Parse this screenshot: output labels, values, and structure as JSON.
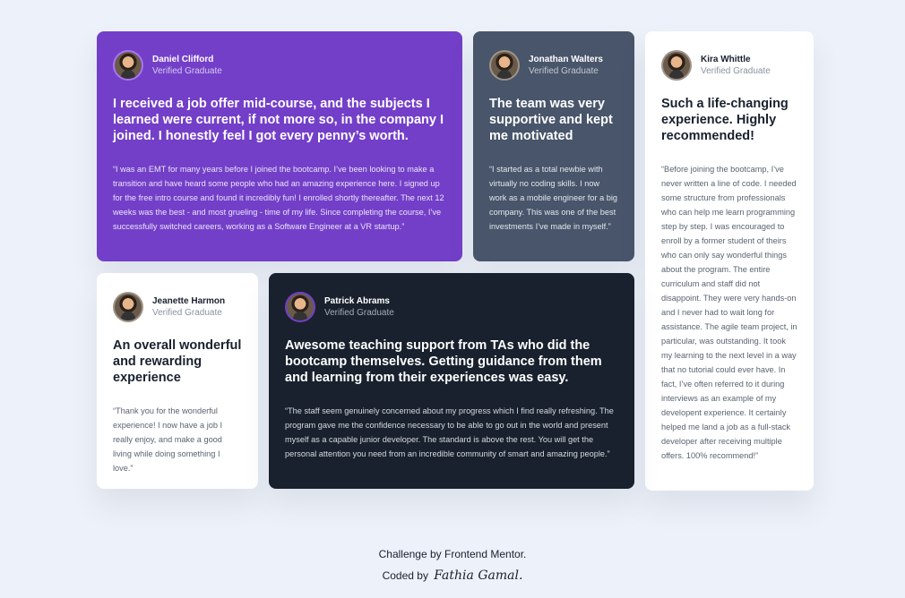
{
  "testimonials": [
    {
      "name": "Daniel Clifford",
      "status": "Verified Graduate",
      "headline": "I received a job offer mid-course, and the subjects I learned were current, if not more so, in the company I joined. I honestly feel I got every penny’s worth.",
      "quote": "“I was an EMT for many years before I joined the bootcamp. I’ve been looking to make a transition and have heard some people who had an amazing experience here. I signed up for the free intro course and found it incredibly fun! I enrolled shortly thereafter. The next 12 weeks was the best - and most grueling - time of my life. Since completing the course, I’ve successfully switched careers, working as a Software Engineer at a VR startup.”"
    },
    {
      "name": "Jonathan Walters",
      "status": "Verified Graduate",
      "headline": "The team was very supportive and kept me motivated",
      "quote": "“I started as a total newbie with virtually no coding skills. I now work as a mobile engineer for a big company. This was one of the best investments I’ve made in myself.”"
    },
    {
      "name": "Kira Whittle",
      "status": "Verified Graduate",
      "headline": "Such a life-changing experience. Highly recommended!",
      "quote": "“Before joining the bootcamp, I’ve never written a line of code. I needed some structure from professionals who can help me learn programming step by step. I was encouraged to enroll by a former student of theirs who can only say wonderful things about the program. The entire curriculum and staff did not disappoint. They were very hands-on and I never had to wait long for assistance. The agile team project, in particular, was outstanding. It took my learning to the next level in a way that no tutorial could ever have. In fact, I’ve often referred to it during interviews as an example of my developent experience. It certainly helped me land a job as a full-stack developer after receiving multiple offers. 100% recommend!”"
    },
    {
      "name": "Jeanette Harmon",
      "status": "Verified Graduate",
      "headline": "An overall wonderful and rewarding experience",
      "quote": "“Thank you for the wonderful experience! I now have a job I really enjoy, and make a good living while doing something I love.”"
    },
    {
      "name": "Patrick Abrams",
      "status": "Verified Graduate",
      "headline": "Awesome teaching support from TAs who did the bootcamp themselves. Getting guidance from them and learning from their experiences was easy.",
      "quote": "“The staff seem genuinely concerned about my progress which I find really refreshing. The program gave me the confidence necessary to be able to go out in the world and present myself as a capable junior developer. The standard is above the rest. You will get the personal attention you need from an incredible community of smart and amazing people.”"
    }
  ],
  "footer": {
    "challenge_text": "Challenge by Frontend Mentor.",
    "coded_by_text": "Coded by",
    "author": "Fathia Gamal."
  },
  "colors": {
    "background": "#edf1f9",
    "purple": "#733fc8",
    "grayish_blue": "#48556a",
    "dark_blue": "#19212e",
    "white": "#ffffff"
  }
}
